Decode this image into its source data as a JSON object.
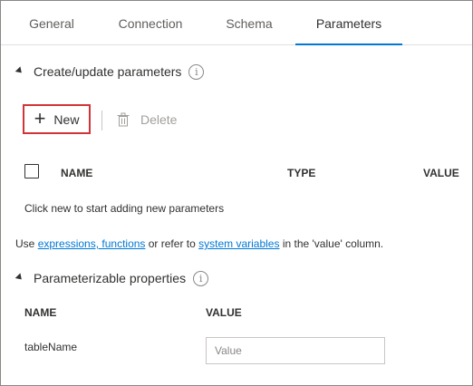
{
  "tabs": [
    {
      "label": "General",
      "active": false
    },
    {
      "label": "Connection",
      "active": false
    },
    {
      "label": "Schema",
      "active": false
    },
    {
      "label": "Parameters",
      "active": true
    }
  ],
  "create_section": {
    "title": "Create/update parameters",
    "toolbar": {
      "new_label": "New",
      "delete_label": "Delete"
    },
    "table": {
      "headers": [
        "NAME",
        "TYPE",
        "VALUE"
      ]
    },
    "empty_message": "Click new to start adding new parameters"
  },
  "help_text": {
    "prefix": "Use ",
    "link1": "expressions, functions",
    "middle": " or refer to ",
    "link2": "system variables",
    "suffix": " in the 'value' column."
  },
  "param_section": {
    "title": "Parameterizable properties",
    "headers": [
      "NAME",
      "VALUE"
    ],
    "rows": [
      {
        "name": "tableName",
        "value": "",
        "placeholder": "Value"
      }
    ]
  },
  "colors": {
    "accent": "#0078d4",
    "highlight_border": "#d13438",
    "disabled_text": "#a19f9d"
  },
  "icons": [
    "triangle-collapse-icon",
    "info-icon",
    "plus-icon",
    "trash-icon"
  ]
}
